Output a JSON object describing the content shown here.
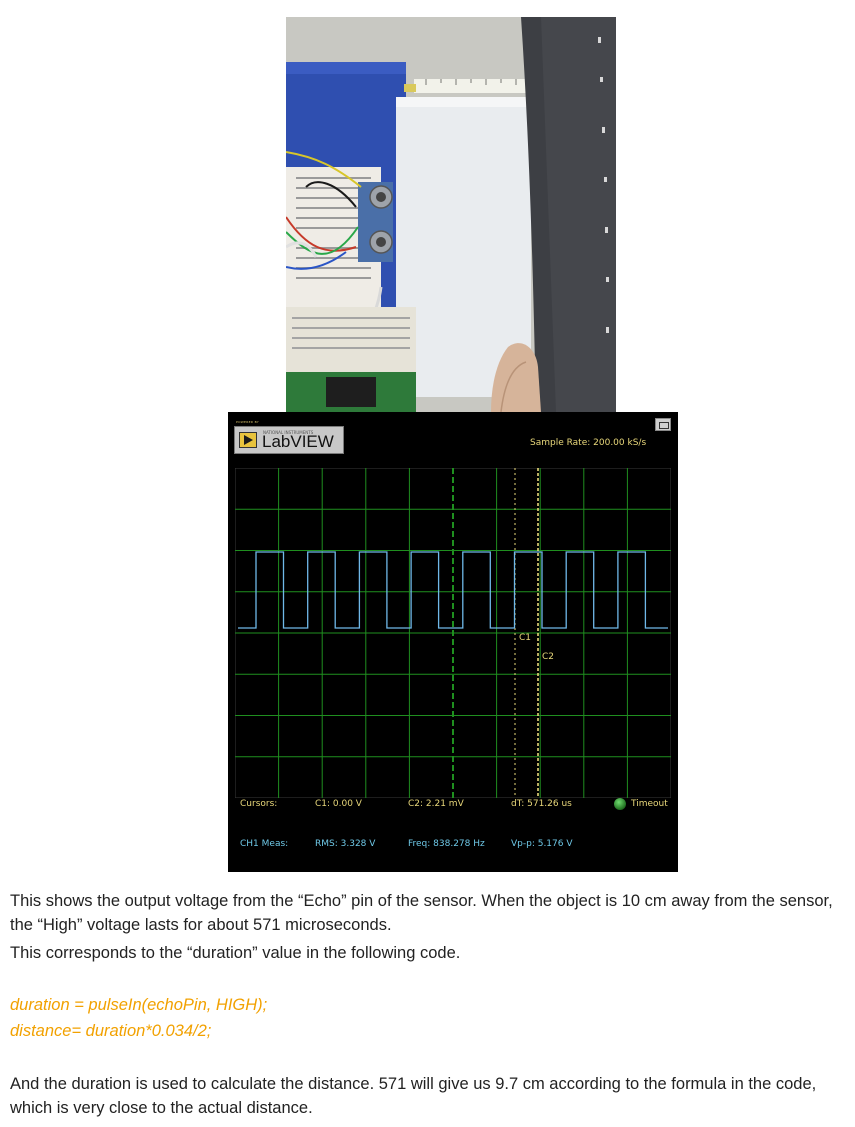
{
  "labview": {
    "powered_by": "POWERED BY",
    "vendor": "NATIONAL INSTRUMENTS",
    "logo_text": "LabVIEW",
    "sample_rate": "Sample Rate:  200.00 kS/s",
    "cursor_labels": {
      "c1": "C1",
      "c2": "C2"
    },
    "cursors": {
      "label": "Cursors:",
      "c1": "C1:  0.00 V",
      "c2": "C2:  2.21 mV",
      "dt": "dT:  571.26 us",
      "timeout": "Timeout"
    },
    "meas": {
      "label": "CH1 Meas:",
      "rms": "RMS:  3.328 V",
      "freq": "Freq:  838.278 Hz",
      "vpp": "Vp-p:  5.176 V"
    },
    "colors": {
      "grid": "#1f8f1f",
      "trace": "#6fb8e8",
      "cursor": "#e8d77a"
    }
  },
  "text": {
    "p1": "This shows the output voltage from the “Echo” pin of the sensor. When the object is 10 cm away from the sensor, the “High” voltage lasts for about 571 microseconds.",
    "p2": "This corresponds to the “duration” value in the following code.",
    "code1": "duration = pulseIn(echoPin, HIGH);",
    "code2": "distance= duration*0.034/2;",
    "p3": "And the duration is used to calculate the distance. 571 will give us 9.7 cm according to the formula in the code, which is very close to the actual distance."
  }
}
